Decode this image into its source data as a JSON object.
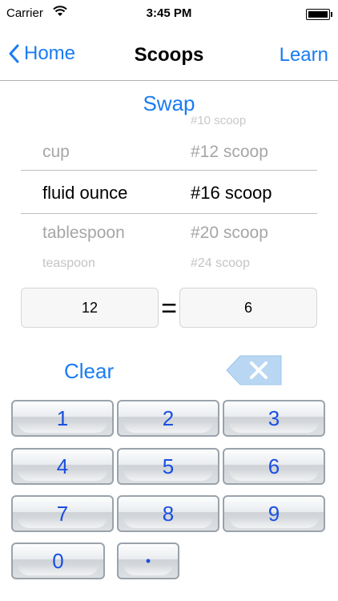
{
  "status_bar": {
    "carrier": "Carrier",
    "time": "3:45 PM"
  },
  "nav": {
    "back_label": "Home",
    "title": "Scoops",
    "right_label": "Learn"
  },
  "swap_label": "Swap",
  "picker": {
    "left": [
      "cup",
      "fluid ounce",
      "tablespoon",
      "teaspoon"
    ],
    "right": [
      "#10 scoop",
      "#12 scoop",
      "#16 scoop",
      "#20 scoop",
      "#24 scoop"
    ]
  },
  "converter": {
    "left_value": "12",
    "equals": "=",
    "right_value": "6"
  },
  "clear_label": "Clear",
  "keypad": [
    "1",
    "2",
    "3",
    "4",
    "5",
    "6",
    "7",
    "8",
    "9",
    "0",
    "•"
  ],
  "colors": {
    "accent": "#1a7cf2",
    "key_text": "#1a4fe0",
    "backspace": "#b9d7f3"
  }
}
